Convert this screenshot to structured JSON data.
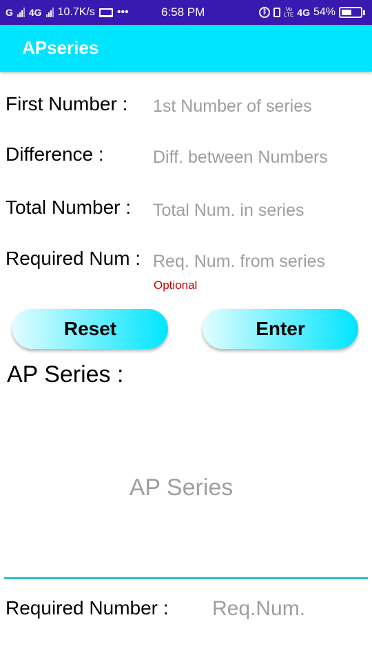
{
  "status_bar": {
    "net_speed": "10.7K/s",
    "time": "6:58 PM",
    "battery": "54%",
    "network_label_1": "4G",
    "network_label_2": "4G",
    "more": "•••"
  },
  "app_bar": {
    "title": "APseries"
  },
  "form": {
    "first_number": {
      "label": "First Number :",
      "placeholder": "1st Number of series"
    },
    "difference": {
      "label": "Difference :",
      "placeholder": "Diff. between Numbers"
    },
    "total_number": {
      "label": "Total Number :",
      "placeholder": "Total Num. in series"
    },
    "required_num": {
      "label": "Required Num :",
      "placeholder": "Req. Num. from series",
      "hint": "Optional"
    }
  },
  "buttons": {
    "reset": "Reset",
    "enter": "Enter"
  },
  "output": {
    "series_title": "AP Series :",
    "series_value": "AP Series",
    "required_label": "Required Number :",
    "required_value": "Req.Num."
  }
}
